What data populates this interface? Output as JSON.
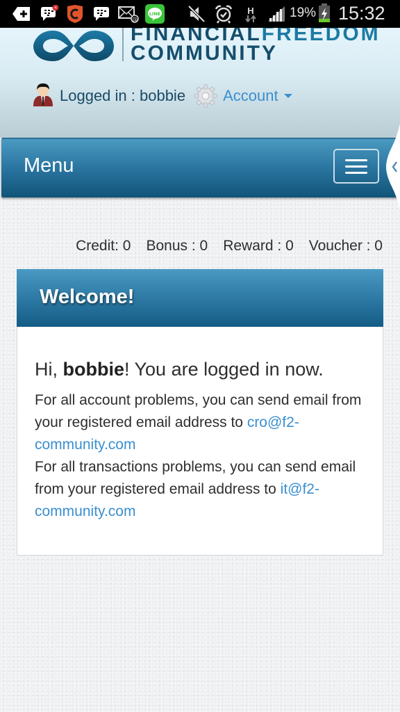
{
  "status_bar": {
    "notification_icons": [
      "add-notification-icon",
      "bbm-chat-icon",
      "security-app-icon",
      "bbm-icon",
      "email-icon",
      "line-app-icon"
    ],
    "system_icons": [
      "mute-icon",
      "alarm-icon",
      "data-hspa-icon",
      "signal-icon"
    ],
    "data_label": "H",
    "battery_percent": "19%",
    "time": "15:32"
  },
  "header": {
    "logo": {
      "line1_part1": "FINANCIAL",
      "line1_part2": "FREEDOM",
      "line2": "COMMUNITY"
    },
    "logged_in_label": "Logged in : bobbie",
    "account_label": "Account"
  },
  "menubar": {
    "label": "Menu"
  },
  "balances": [
    {
      "label": "Credit: 0"
    },
    {
      "label": "Bonus : 0"
    },
    {
      "label": "Reward : 0"
    },
    {
      "label": "Voucher : 0"
    }
  ],
  "welcome": {
    "title": "Welcome!",
    "greeting_prefix": "Hi, ",
    "username": "bobbie",
    "greeting_suffix": "! You are logged in now.",
    "account_text": "For all account problems, you can send email from your registered email address to ",
    "account_email": "cro@f2-community.com",
    "transactions_text": "For all transactions problems, you can send email from your registered email address to ",
    "transactions_email": "it@f2-community.com"
  },
  "colors": {
    "brand_dark": "#154e6c",
    "brand_accent": "#1d7aa4",
    "link": "#3a8fcf",
    "bar_top": "#4a9ac1",
    "bar_bottom": "#105478"
  }
}
